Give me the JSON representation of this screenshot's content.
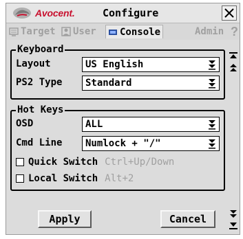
{
  "titlebar": {
    "brand": "Avocent.",
    "title": "Configure",
    "close_icon": "close-icon"
  },
  "tabs": [
    {
      "label": "Target",
      "icon": "target-icon",
      "state": "disabled"
    },
    {
      "label": "User",
      "icon": "user-icon",
      "state": "disabled"
    },
    {
      "label": "Console",
      "icon": "console-icon",
      "state": "active"
    },
    {
      "label": "Admin",
      "icon": "",
      "state": "disabled"
    }
  ],
  "help_label": "?",
  "keyboard": {
    "legend": "Keyboard",
    "layout_label": "Layout",
    "layout_value": "US English",
    "ps2_label": "PS2 Type",
    "ps2_value": "Standard"
  },
  "hotkeys": {
    "legend": "Hot Keys",
    "osd_label": "OSD",
    "osd_value": "ALL",
    "cmd_label": "Cmd Line",
    "cmd_value": "Numlock + \"/\"",
    "quick_switch_label": "Quick Switch",
    "quick_switch_hint": "Ctrl+Up/Down",
    "quick_switch_checked": false,
    "local_switch_label": "Local Switch",
    "local_switch_hint": "Alt+2",
    "local_switch_checked": false
  },
  "buttons": {
    "apply": "Apply",
    "cancel": "Cancel"
  },
  "colors": {
    "brand_red": "#c8102e",
    "disabled_text": "#a0a0a0",
    "panel_bg": "#dcdcdc"
  }
}
